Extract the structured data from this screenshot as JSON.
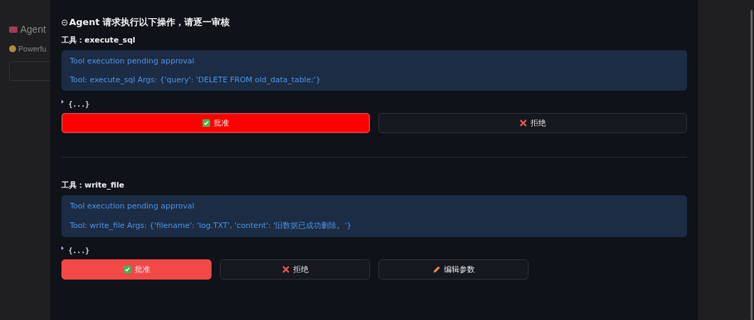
{
  "background": {
    "app_title": "Agent",
    "subtitle": "Powerfu"
  },
  "dialog": {
    "title": "Agent 请求执行以下操作，请逐一审核",
    "tools": [
      {
        "label": "工具：execute_sql",
        "status": "Tool execution pending approval",
        "detail": "Tool: execute_sql Args: {'query': 'DELETE FROM old_data_table;'}",
        "json_preview": "{...}",
        "expanded": false,
        "wide": true,
        "buttons": [
          {
            "kind": "approve",
            "label": "批准",
            "focused": true
          },
          {
            "kind": "reject",
            "label": "拒绝",
            "focused": false
          }
        ]
      },
      {
        "label": "工具：write_file",
        "status": "Tool execution pending approval",
        "detail": "Tool: write_file Args: {'filename': 'log.TXT', 'content': '旧数据已成功删除。'}",
        "json_preview": "{...}",
        "expanded": false,
        "wide": false,
        "buttons": [
          {
            "kind": "approve",
            "label": "批准",
            "focused": false
          },
          {
            "kind": "reject",
            "label": "拒绝",
            "focused": false
          },
          {
            "kind": "edit",
            "label": "编辑参数",
            "focused": false
          }
        ]
      }
    ]
  }
}
